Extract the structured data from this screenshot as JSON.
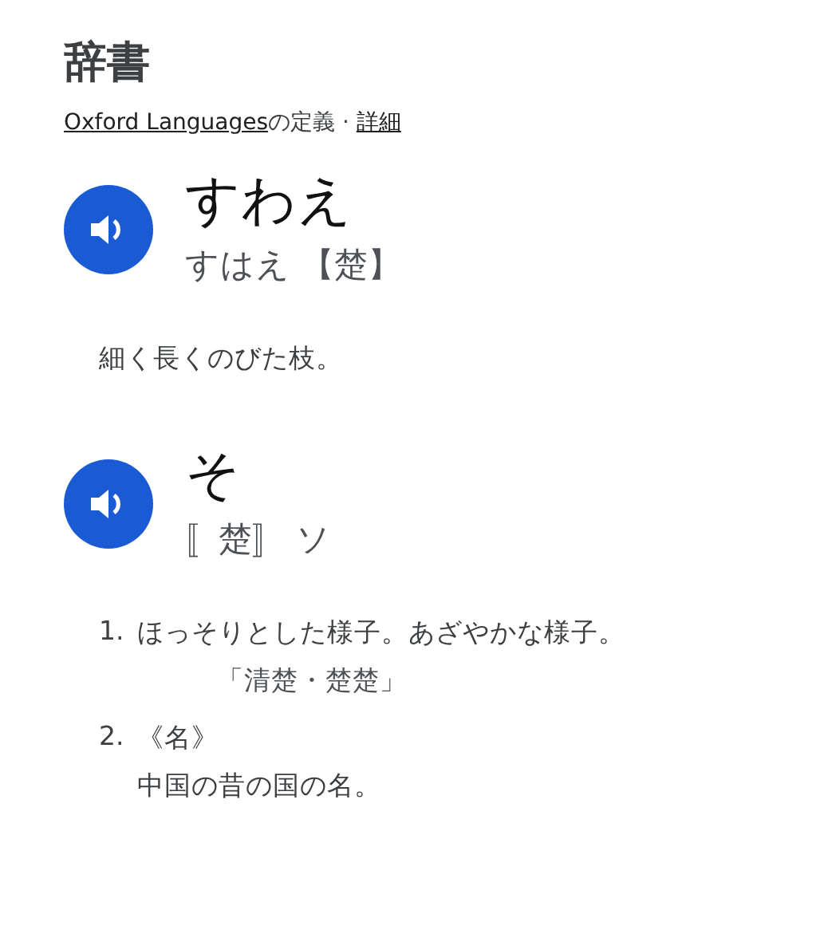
{
  "title": "辞書",
  "source": {
    "link": "Oxford Languages",
    "text": "の定義 · ",
    "details_link": "詳細"
  },
  "entries": [
    {
      "headword": "すわえ",
      "reading": "すはえ 【楚】",
      "definitions": [
        {
          "text": "細く長くのびた枝。"
        }
      ]
    },
    {
      "headword": "そ",
      "reading": "〚楚〛 ソ",
      "definitions": [
        {
          "number": "1.",
          "text": "ほっそりとした様子。あざやかな様子。",
          "example": "「清楚・楚楚」"
        },
        {
          "number": "2.",
          "label": "《名》",
          "text": "中国の昔の国の名。"
        }
      ]
    }
  ]
}
